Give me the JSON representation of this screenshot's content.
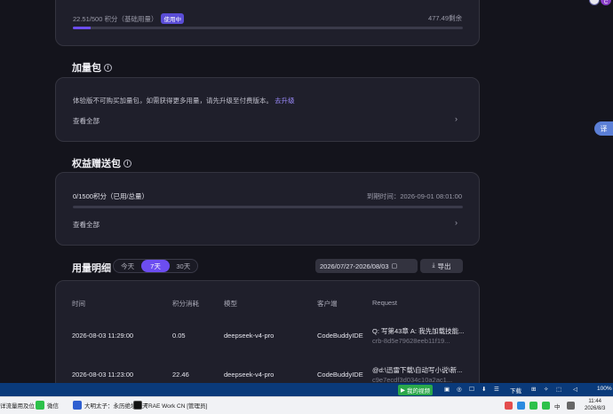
{
  "usage_card": {
    "usage_text": "22.51/500 积分（基础用量）",
    "badge": "使用中",
    "remaining": "477.49剩余",
    "progress_fraction": 0.045
  },
  "addon_section": {
    "title": "加量包",
    "info_icon": "info-icon",
    "notice": "体验版不可购买加量包，如需获得更多用量，请先升级至付费版本。",
    "upgrade_link": "去升级",
    "view_all": "查看全部"
  },
  "gift_section": {
    "title": "权益赠送包",
    "points": "0/1500积分（已用/总量）",
    "expiry": "到期时间：2026-09-01 08:01:00",
    "progress_fraction": 0,
    "view_all": "查看全部"
  },
  "usage_details": {
    "title": "用量明细",
    "tabs": [
      "今天",
      "7天",
      "30天"
    ],
    "active_tab": "7天",
    "date_range": "2026/07/27-2026/08/03",
    "export_label": "导出",
    "columns": [
      "时间",
      "积分消耗",
      "模型",
      "客户端",
      "Request"
    ],
    "rows": [
      {
        "time": "2026-08-03 11:29:00",
        "points": "0.05",
        "model": "deepseek-v4-pro",
        "client": "CodeBuddyIDE",
        "request": "Q: 写第43章 A: 我先加载技能...",
        "request_id": "crb-8d5e79628eeb11f19..."
      },
      {
        "time": "2026-08-03 11:23:00",
        "points": "22.46",
        "model": "deepseek-v4-pro",
        "client": "CodeBuddyIDE",
        "request": "@d:\\迅雷下载\\自动写小说\\新...",
        "request_id": "c9e7ecdf3d034c10a2ac1..."
      }
    ]
  },
  "translate_button": "译",
  "avatar_label": "C",
  "statusbar": {
    "left_label": "我的视频",
    "download": "下载",
    "zoom": "100%"
  },
  "taskbar": {
    "items": [
      {
        "label": "详流量用及位"
      },
      {
        "label": "微信"
      },
      {
        "label": "大明太子：永历绝境开天"
      },
      {
        "label": "TRAE Work CN [管理员]"
      }
    ],
    "time": "11:44",
    "date": "2026/8/3",
    "ime": "中"
  },
  "colors": {
    "accent": "#6c4df0",
    "link": "#9d8cff",
    "background": "#14141c",
    "card": "#1f1f2b"
  }
}
